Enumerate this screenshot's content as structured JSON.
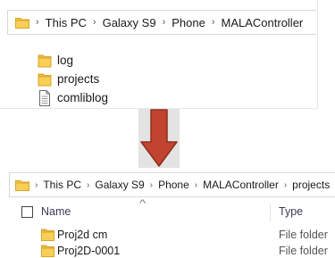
{
  "top_window": {
    "breadcrumb": [
      "This PC",
      "Galaxy S9",
      "Phone",
      "MALAController"
    ],
    "files": [
      {
        "name": "log",
        "icon": "folder-icon"
      },
      {
        "name": "projects",
        "icon": "folder-icon"
      },
      {
        "name": "comliblog",
        "icon": "document-icon"
      }
    ]
  },
  "arrow": {
    "icon": "down-arrow-icon",
    "color": "#c0442e"
  },
  "bottom_window": {
    "breadcrumb": [
      "This PC",
      "Galaxy S9",
      "Phone",
      "MALAController",
      "projects"
    ],
    "header": {
      "name_label": "Name",
      "type_label": "Type",
      "sort_icon": "chevron-up-icon"
    },
    "rows": [
      {
        "name": "Proj2d cm",
        "type": "File folder",
        "icon": "folder-icon"
      },
      {
        "name": "Proj2D-0001",
        "type": "File folder",
        "icon": "folder-icon"
      }
    ]
  },
  "colors": {
    "folder": "#f2c54a",
    "folder_dark": "#d9a627",
    "accent": "#c0442e"
  }
}
